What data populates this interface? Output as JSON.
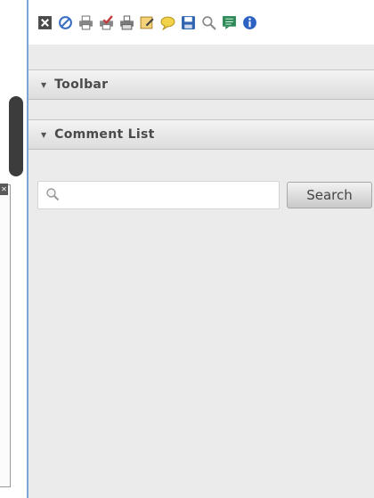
{
  "toolbar": {
    "buttons": [
      {
        "icon": "close-icon",
        "color": "#4a4a4a"
      },
      {
        "icon": "no-entry-icon",
        "color": "#3a6fc4"
      },
      {
        "icon": "print-icon",
        "color": "#777777"
      },
      {
        "icon": "print-check-icon",
        "color": "#c23b3b"
      },
      {
        "icon": "print-preview-icon",
        "color": "#6a6a6a"
      },
      {
        "icon": "note-edit-icon",
        "color": "#d1a640"
      },
      {
        "icon": "comment-icon",
        "color": "#e6c23a"
      },
      {
        "icon": "save-icon",
        "color": "#2f64b0"
      },
      {
        "icon": "search-icon",
        "color": "#8a8a8a"
      },
      {
        "icon": "comment-list-icon",
        "color": "#2f8a5a"
      },
      {
        "icon": "info-icon",
        "color": "#2d62c2"
      }
    ]
  },
  "sections": {
    "toolbar_label": "Toolbar",
    "comment_list_label": "Comment List"
  },
  "search": {
    "placeholder": "",
    "value": "",
    "button_label": "Search"
  },
  "colors": {
    "panel_bg": "#ebebeb",
    "panel_border": "#7aa7d8",
    "scroll_thumb": "#3c3c3c"
  }
}
